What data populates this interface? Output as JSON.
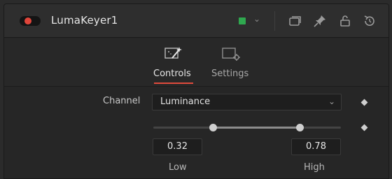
{
  "node": {
    "title": "LumaKeyer1",
    "toggle_dot_color": "#e0453a",
    "color_swatch": "#2fa84f",
    "icons": [
      "chevron-down-icon",
      "versions-icon",
      "pin-icon",
      "lock-icon",
      "reset-icon"
    ]
  },
  "tabs": [
    {
      "label": "Controls",
      "icon": "controls-wand-icon",
      "active": true
    },
    {
      "label": "Settings",
      "icon": "settings-gear-icon",
      "active": false
    }
  ],
  "accent": "#e04a3c",
  "channel": {
    "label": "Channel",
    "value": "Luminance"
  },
  "range": {
    "low": 0.32,
    "high": 0.78,
    "low_display": "0.32",
    "high_display": "0.78",
    "low_label": "Low",
    "high_label": "High"
  }
}
